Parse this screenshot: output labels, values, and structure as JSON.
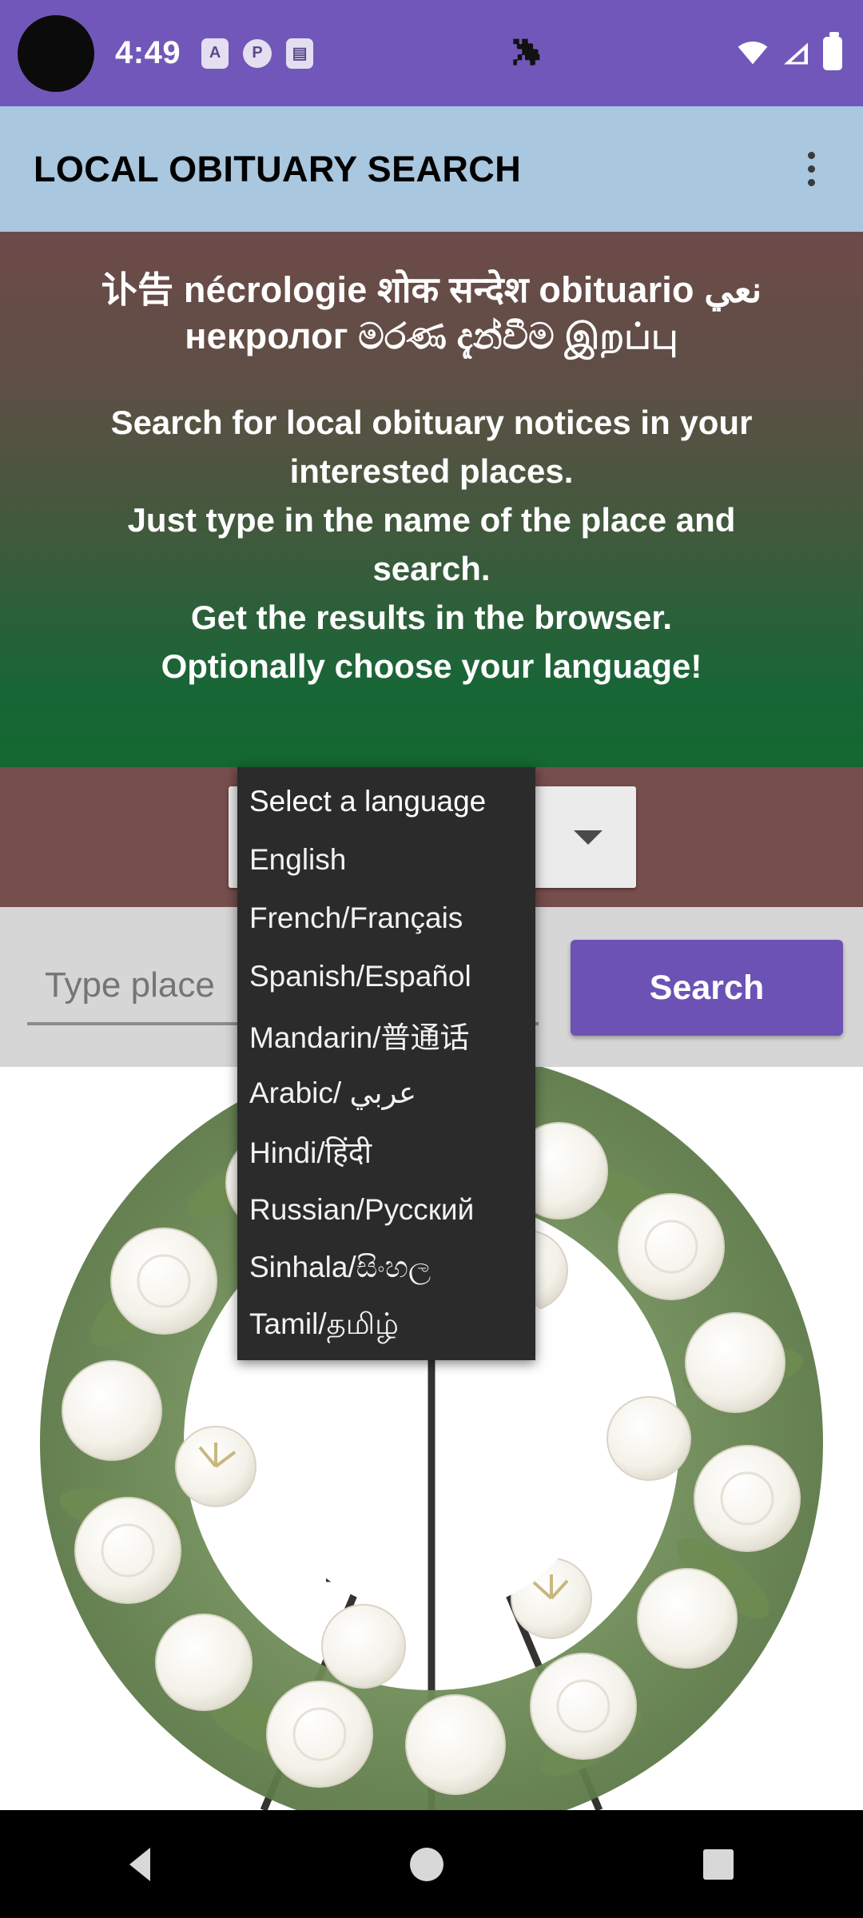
{
  "status_bar": {
    "time": "4:49",
    "icons": [
      {
        "name": "app-badge-a",
        "glyph": "A"
      },
      {
        "name": "app-badge-p",
        "glyph": "P"
      },
      {
        "name": "sd-card-icon",
        "glyph": "▤"
      }
    ],
    "center_icon": "puzzle-icon",
    "right_icons": [
      "wifi-icon",
      "signal-icon",
      "battery-icon"
    ],
    "accent_color": "#7257ba"
  },
  "app_bar": {
    "title": "LOCAL OBITUARY SEARCH",
    "overflow_menu": "more-options",
    "background_color": "#a9c7de"
  },
  "hero": {
    "languages_line1": "讣告 nécrologie शोक सन्देश obituario نعي",
    "languages_line2": "некролог මරණ දැන්වීම இறப்பு",
    "body_line1": "Search for local obituary notices in your",
    "body_line2": "interested places.",
    "body_line3": "Just type in the name of the place and",
    "body_line4": "search.",
    "body_line5": "Get the results in the browser.",
    "body_line6": "Optionally choose your language!"
  },
  "language_spinner": {
    "selected": "",
    "arrow_icon": "chevron-down-icon",
    "options": [
      "Select a language",
      "English",
      "French/Français",
      "Spanish/Español",
      "Mandarin/普通话",
      "Arabic/ عربي",
      "Hindi/हिंदी",
      "Russian/Русский",
      "Sinhala/සිංහල",
      "Tamil/தமிழ்"
    ]
  },
  "search": {
    "placeholder": "Type place",
    "value": "",
    "button_label": "Search",
    "button_color": "#6c52b5"
  },
  "image": {
    "alt": "white funeral wreath of lilies roses and carnations on a stand"
  },
  "nav_bar": {
    "back": "back-button",
    "home": "home-button",
    "recents": "recents-button"
  }
}
